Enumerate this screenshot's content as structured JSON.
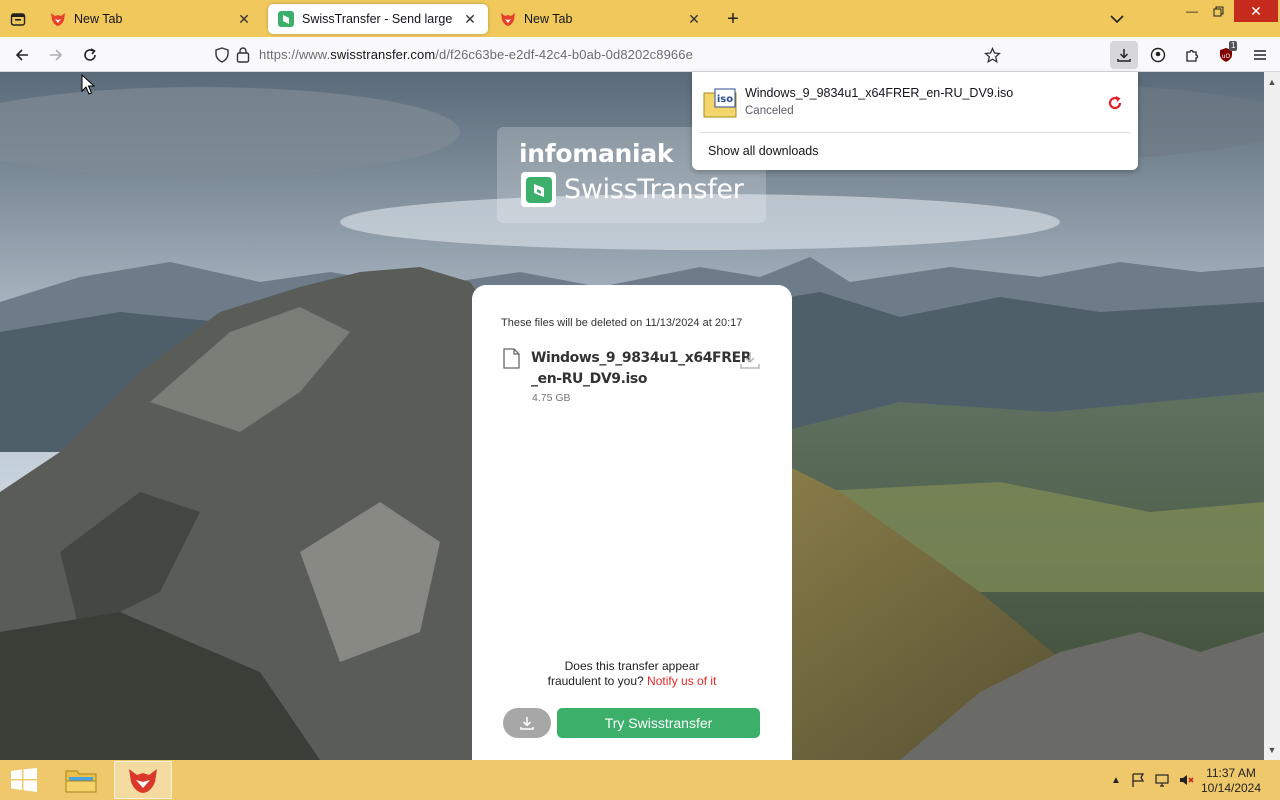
{
  "browser": {
    "tabs": [
      {
        "title": "New Tab",
        "active": false,
        "icon": "firefox-fox-icon"
      },
      {
        "title": "SwissTransfer - Send large files",
        "active": true,
        "icon": "swisstransfer-icon"
      },
      {
        "title": "New Tab",
        "active": false,
        "icon": "firefox-fox-icon"
      }
    ],
    "url_prefix": "https://www.",
    "url_domain": "swisstransfer.com",
    "url_path": "/d/f26c63be-e2df-42c4-b0ab-0d8202c8966e",
    "extension_badge": "1"
  },
  "downloads_panel": {
    "item": {
      "filename": "Windows_9_9834u1_x64FRER_en-RU_DV9.iso",
      "status": "Canceled",
      "file_icon_label": "iso"
    },
    "show_all_label": "Show all downloads"
  },
  "page": {
    "brand": {
      "company": "infomaniak",
      "product": "SwissTransfer"
    },
    "card": {
      "delete_note": "These files will be deleted on 11/13/2024 at 20:17",
      "file": {
        "name_line1": "Windows_9_9834u1_x64FRER",
        "name_line2": "_en-RU_DV9.iso",
        "size": "4.75 GB"
      },
      "fraud_question_line1": "Does this transfer appear",
      "fraud_question_line2": "fraudulent to you?",
      "fraud_link": "Notify us of it",
      "try_button": "Try Swisstransfer"
    }
  },
  "taskbar": {
    "time": "11:37 AM",
    "date": "10/14/2024"
  },
  "colors": {
    "theme_yellow": "#f0c85c",
    "accent_green": "#3cb06a",
    "link_red": "#e02a2a",
    "close_red": "#c42b1c"
  }
}
